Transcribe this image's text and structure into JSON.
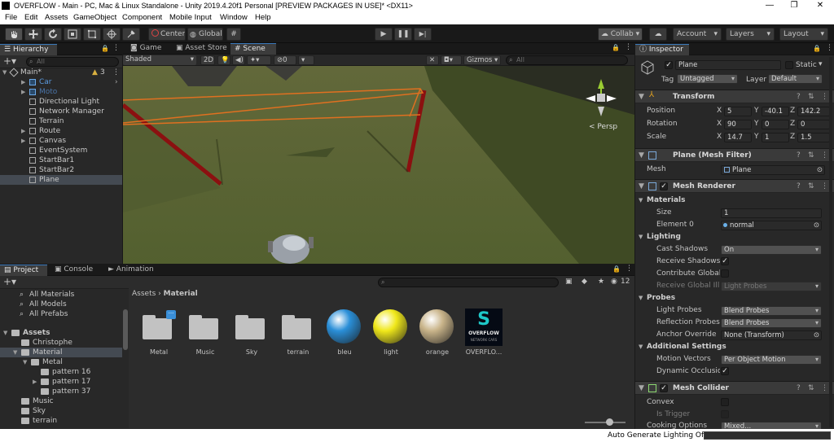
{
  "window": {
    "title": "OVERFLOW - Main - PC, Mac & Linux Standalone - Unity 2019.4.20f1 Personal [PREVIEW PACKAGES IN USE]* <DX11>",
    "minimize": "—",
    "maximize": "❐",
    "close": "✕"
  },
  "menu": [
    "File",
    "Edit",
    "Assets",
    "GameObject",
    "Component",
    "Mobile Input",
    "Window",
    "Help"
  ],
  "toolbar": {
    "pivot_center": "Center",
    "pivot_global": "Global",
    "collab": "Collab",
    "account": "Account",
    "layers": "Layers",
    "layout": "Layout",
    "tools": [
      "hand",
      "move",
      "rotate",
      "scale",
      "rect",
      "transform"
    ]
  },
  "hierarchy": {
    "tab": "Hierarchy",
    "search_placeholder": "All",
    "scene_name": "Main*",
    "scene_badge": "3",
    "items": [
      {
        "label": "Car",
        "color": "#5b9be0",
        "expandable": true,
        "indent": 1
      },
      {
        "label": "Moto",
        "color": "#4a74a8",
        "expandable": true,
        "indent": 1
      },
      {
        "label": "Directional Light",
        "color": "#c8c8c8",
        "expandable": false,
        "indent": 1
      },
      {
        "label": "Network Manager",
        "color": "#c8c8c8",
        "expandable": false,
        "indent": 1
      },
      {
        "label": "Terrain",
        "color": "#c8c8c8",
        "expandable": false,
        "indent": 1
      },
      {
        "label": "Route",
        "color": "#c8c8c8",
        "expandable": true,
        "indent": 1
      },
      {
        "label": "Canvas",
        "color": "#c8c8c8",
        "expandable": true,
        "indent": 1
      },
      {
        "label": "EventSystem",
        "color": "#c8c8c8",
        "expandable": false,
        "indent": 1
      },
      {
        "label": "StartBar1",
        "color": "#c8c8c8",
        "expandable": false,
        "indent": 1
      },
      {
        "label": "StartBar2",
        "color": "#c8c8c8",
        "expandable": false,
        "indent": 1
      },
      {
        "label": "Plane",
        "color": "#c8c8c8",
        "expandable": false,
        "indent": 1,
        "selected": true
      }
    ]
  },
  "center_tabs": [
    "Game",
    "Asset Store",
    "Scene"
  ],
  "scene_toolbar": {
    "shading": "Shaded",
    "mode_2d": "2D",
    "hidden_count": "0",
    "gizmos": "Gizmos",
    "search_placeholder": "All",
    "persp": "< Persp"
  },
  "bottom_tabs": [
    "Project",
    "Console",
    "Animation"
  ],
  "project": {
    "favorites": [
      "All Materials",
      "All Models",
      "All Prefabs"
    ],
    "tree": [
      {
        "label": "Assets",
        "indent": 0,
        "expanded": true,
        "bold": true
      },
      {
        "label": "Christophe",
        "indent": 1,
        "expanded": false
      },
      {
        "label": "Material",
        "indent": 1,
        "expanded": true,
        "selected": true
      },
      {
        "label": "Metal",
        "indent": 2,
        "expanded": true
      },
      {
        "label": "pattern 16",
        "indent": 3,
        "expanded": false
      },
      {
        "label": "pattern 17",
        "indent": 3,
        "expanded": false,
        "arrow": true
      },
      {
        "label": "pattern 37",
        "indent": 3,
        "expanded": false
      },
      {
        "label": "Music",
        "indent": 1,
        "expanded": false
      },
      {
        "label": "Sky",
        "indent": 1,
        "expanded": false
      },
      {
        "label": "terrain",
        "indent": 1,
        "expanded": false
      }
    ],
    "breadcrumb": [
      "Assets",
      "Material"
    ],
    "hidden_count": "12",
    "assets": [
      {
        "label": "Metal",
        "kind": "folder"
      },
      {
        "label": "Music",
        "kind": "folder"
      },
      {
        "label": "Sky",
        "kind": "folder"
      },
      {
        "label": "terrain",
        "kind": "folder"
      },
      {
        "label": "bleu",
        "kind": "ball",
        "color": "#2a8fd8"
      },
      {
        "label": "light",
        "kind": "ball",
        "color": "#f0e81a"
      },
      {
        "label": "orange",
        "kind": "ball",
        "color": "#c9b48a"
      },
      {
        "label": "OVERFLO...",
        "kind": "logo",
        "logo_top": "S",
        "logo_text": "OVERFLOW",
        "logo_sub": "NETWORK CARS"
      }
    ]
  },
  "inspector": {
    "tab": "Inspector",
    "object_name": "Plane",
    "static": "Static",
    "tag_label": "Tag",
    "tag_value": "Untagged",
    "layer_label": "Layer",
    "layer_value": "Default",
    "transform": {
      "title": "Transform",
      "position": {
        "label": "Position",
        "x": "5",
        "y": "-40.1",
        "z": "142.2"
      },
      "rotation": {
        "label": "Rotation",
        "x": "90",
        "y": "0",
        "z": "0"
      },
      "scale": {
        "label": "Scale",
        "x": "14.7",
        "y": "1",
        "z": "1.5"
      }
    },
    "mesh_filter": {
      "title": "Plane (Mesh Filter)",
      "mesh_label": "Mesh",
      "mesh_value": "Plane"
    },
    "mesh_renderer": {
      "title": "Mesh Renderer",
      "materials": "Materials",
      "size_label": "Size",
      "size_value": "1",
      "element0_label": "Element 0",
      "element0_value": "normal",
      "lighting": "Lighting",
      "cast_shadows_label": "Cast Shadows",
      "cast_shadows_value": "On",
      "receive_shadows_label": "Receive Shadows",
      "contribute_gi_label": "Contribute Global I",
      "receive_gi_label": "Receive Global Illu",
      "receive_gi_value": "Light Probes",
      "probes": "Probes",
      "light_probes_label": "Light Probes",
      "light_probes_value": "Blend Probes",
      "reflection_probes_label": "Reflection Probes",
      "reflection_probes_value": "Blend Probes",
      "anchor_override_label": "Anchor Override",
      "anchor_override_value": "None (Transform)",
      "additional": "Additional Settings",
      "motion_vectors_label": "Motion Vectors",
      "motion_vectors_value": "Per Object Motion",
      "dynamic_occlusion_label": "Dynamic Occlusio"
    },
    "mesh_collider": {
      "title": "Mesh Collider",
      "convex_label": "Convex",
      "is_trigger_label": "Is Trigger",
      "cooking_label": "Cooking Options",
      "cooking_value": "Mixed..."
    }
  },
  "status": {
    "text": "Auto Generate Lighting Off"
  }
}
